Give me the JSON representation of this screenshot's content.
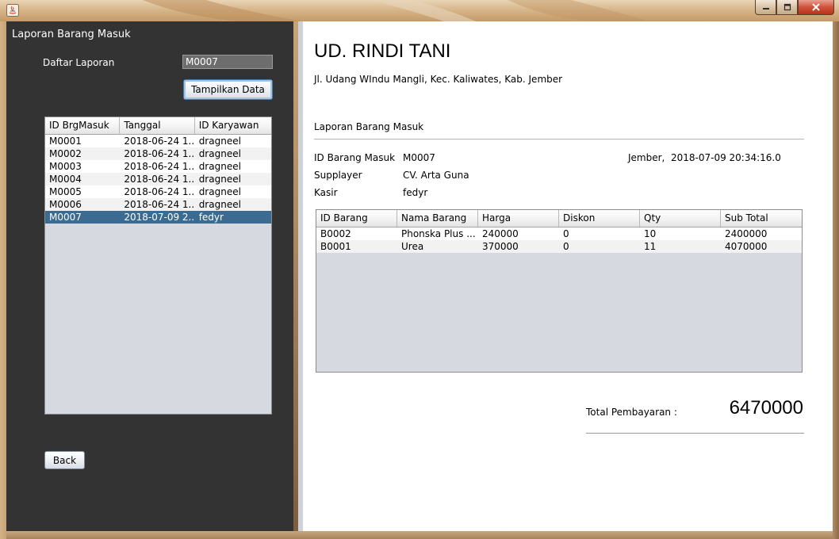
{
  "window": {
    "title": "",
    "minimize_glyph": "–",
    "maximize_glyph": "□",
    "close_glyph": "✕"
  },
  "left": {
    "title": "Laporan Barang Masuk",
    "daftar_label": "Daftar Laporan",
    "daftar_value": "M0007",
    "tampilkan_button": "Tampilkan Data",
    "back_button": "Back",
    "table": {
      "columns": [
        "ID BrgMasuk",
        "Tanggal",
        "ID Karyawan"
      ],
      "rows": [
        [
          "M0001",
          "2018-06-24 1...",
          "dragneel"
        ],
        [
          "M0002",
          "2018-06-24 1...",
          "dragneel"
        ],
        [
          "M0003",
          "2018-06-24 1...",
          "dragneel"
        ],
        [
          "M0004",
          "2018-06-24 1...",
          "dragneel"
        ],
        [
          "M0005",
          "2018-06-24 1...",
          "dragneel"
        ],
        [
          "M0006",
          "2018-06-24 1...",
          "dragneel"
        ],
        [
          "M0007",
          "2018-07-09 2...",
          "fedyr"
        ]
      ],
      "selected_row": 6
    }
  },
  "right": {
    "company": "UD. RINDI TANI",
    "address": "Jl. Udang WIndu Mangli, Kec. Kaliwates, Kab. Jember",
    "report_title": "Laporan Barang Masuk",
    "info": {
      "id_label": "ID Barang Masuk",
      "id_value": "M0007",
      "supplier_label": "Supplayer",
      "supplier_value": "CV. Arta Guna",
      "kasir_label": "Kasir",
      "kasir_value": "fedyr",
      "date_line": "Jember,  2018-07-09 20:34:16.0"
    },
    "table": {
      "columns": [
        "ID Barang",
        "Nama Barang",
        "Harga",
        "Diskon",
        "Qty",
        "Sub Total"
      ],
      "rows": [
        [
          "B0002",
          "Phonska Plus ...",
          "240000",
          "0",
          "10",
          "2400000"
        ],
        [
          "B0001",
          "Urea",
          "370000",
          "0",
          "11",
          "4070000"
        ]
      ]
    },
    "total_label": "Total Pembayaran :",
    "total_value": "6470000"
  },
  "colors": {
    "left_panel_bg": "#333333",
    "selected_row_bg": "#3b6b91",
    "table_empty_bg": "#d6d9df",
    "close_button": "#c8432b"
  }
}
